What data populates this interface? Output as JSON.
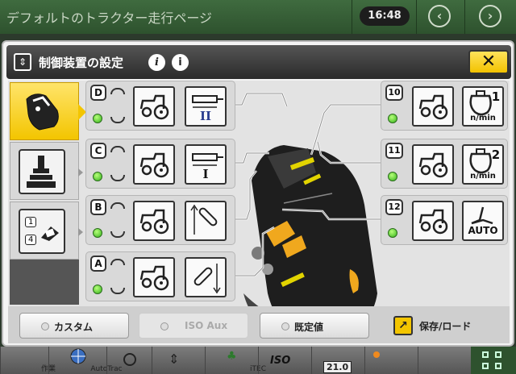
{
  "header": {
    "page_title": "デフォルトのトラクター走行ページ",
    "clock": "16:48",
    "back_icon": "left-arrow-circle-icon",
    "forward_icon": "right-arrow-circle-icon"
  },
  "dialog": {
    "title": "制御装置の設定",
    "info_glyph_1": "i",
    "info_glyph_2": "i",
    "close_label": "✕"
  },
  "left_tabs": [
    {
      "name": "joystick-tab",
      "icon": "joystick-icon",
      "active": true
    },
    {
      "name": "lever-tab",
      "icon": "lever-icon",
      "active": false
    },
    {
      "name": "fingertip-tab",
      "icon": "fingertip-control-icon",
      "labels": [
        "1",
        "4"
      ],
      "active": false
    }
  ],
  "rows": [
    {
      "id": "D",
      "function_label": "II",
      "function_icon": "hitch-cylinder-ii-icon"
    },
    {
      "id": "C",
      "function_label": "I",
      "function_icon": "hitch-cylinder-i-icon"
    },
    {
      "id": "B",
      "function_icon": "loader-arm-up-icon"
    },
    {
      "id": "A",
      "function_icon": "loader-arm-down-icon"
    },
    {
      "id": "10",
      "function_label": "1",
      "function_unit": "n/min",
      "function_icon": "engine-speed-1-icon"
    },
    {
      "id": "11",
      "function_label": "2",
      "function_unit": "n/min",
      "function_icon": "engine-speed-2-icon"
    },
    {
      "id": "12",
      "function_label": "AUTO",
      "function_icon": "auto-icon"
    }
  ],
  "footer": {
    "custom_label": "カスタム",
    "iso_aux_label": "ISO Aux",
    "default_label": "既定値",
    "save_label": "保存/ロード"
  },
  "bottom_bar": {
    "items": [
      "作業",
      "AutoTrac",
      "iTEC",
      "ISO",
      "21.0"
    ]
  },
  "colors": {
    "accent": "#f3c500",
    "status_led": "#34b21b",
    "header_green": "#2e522e"
  }
}
